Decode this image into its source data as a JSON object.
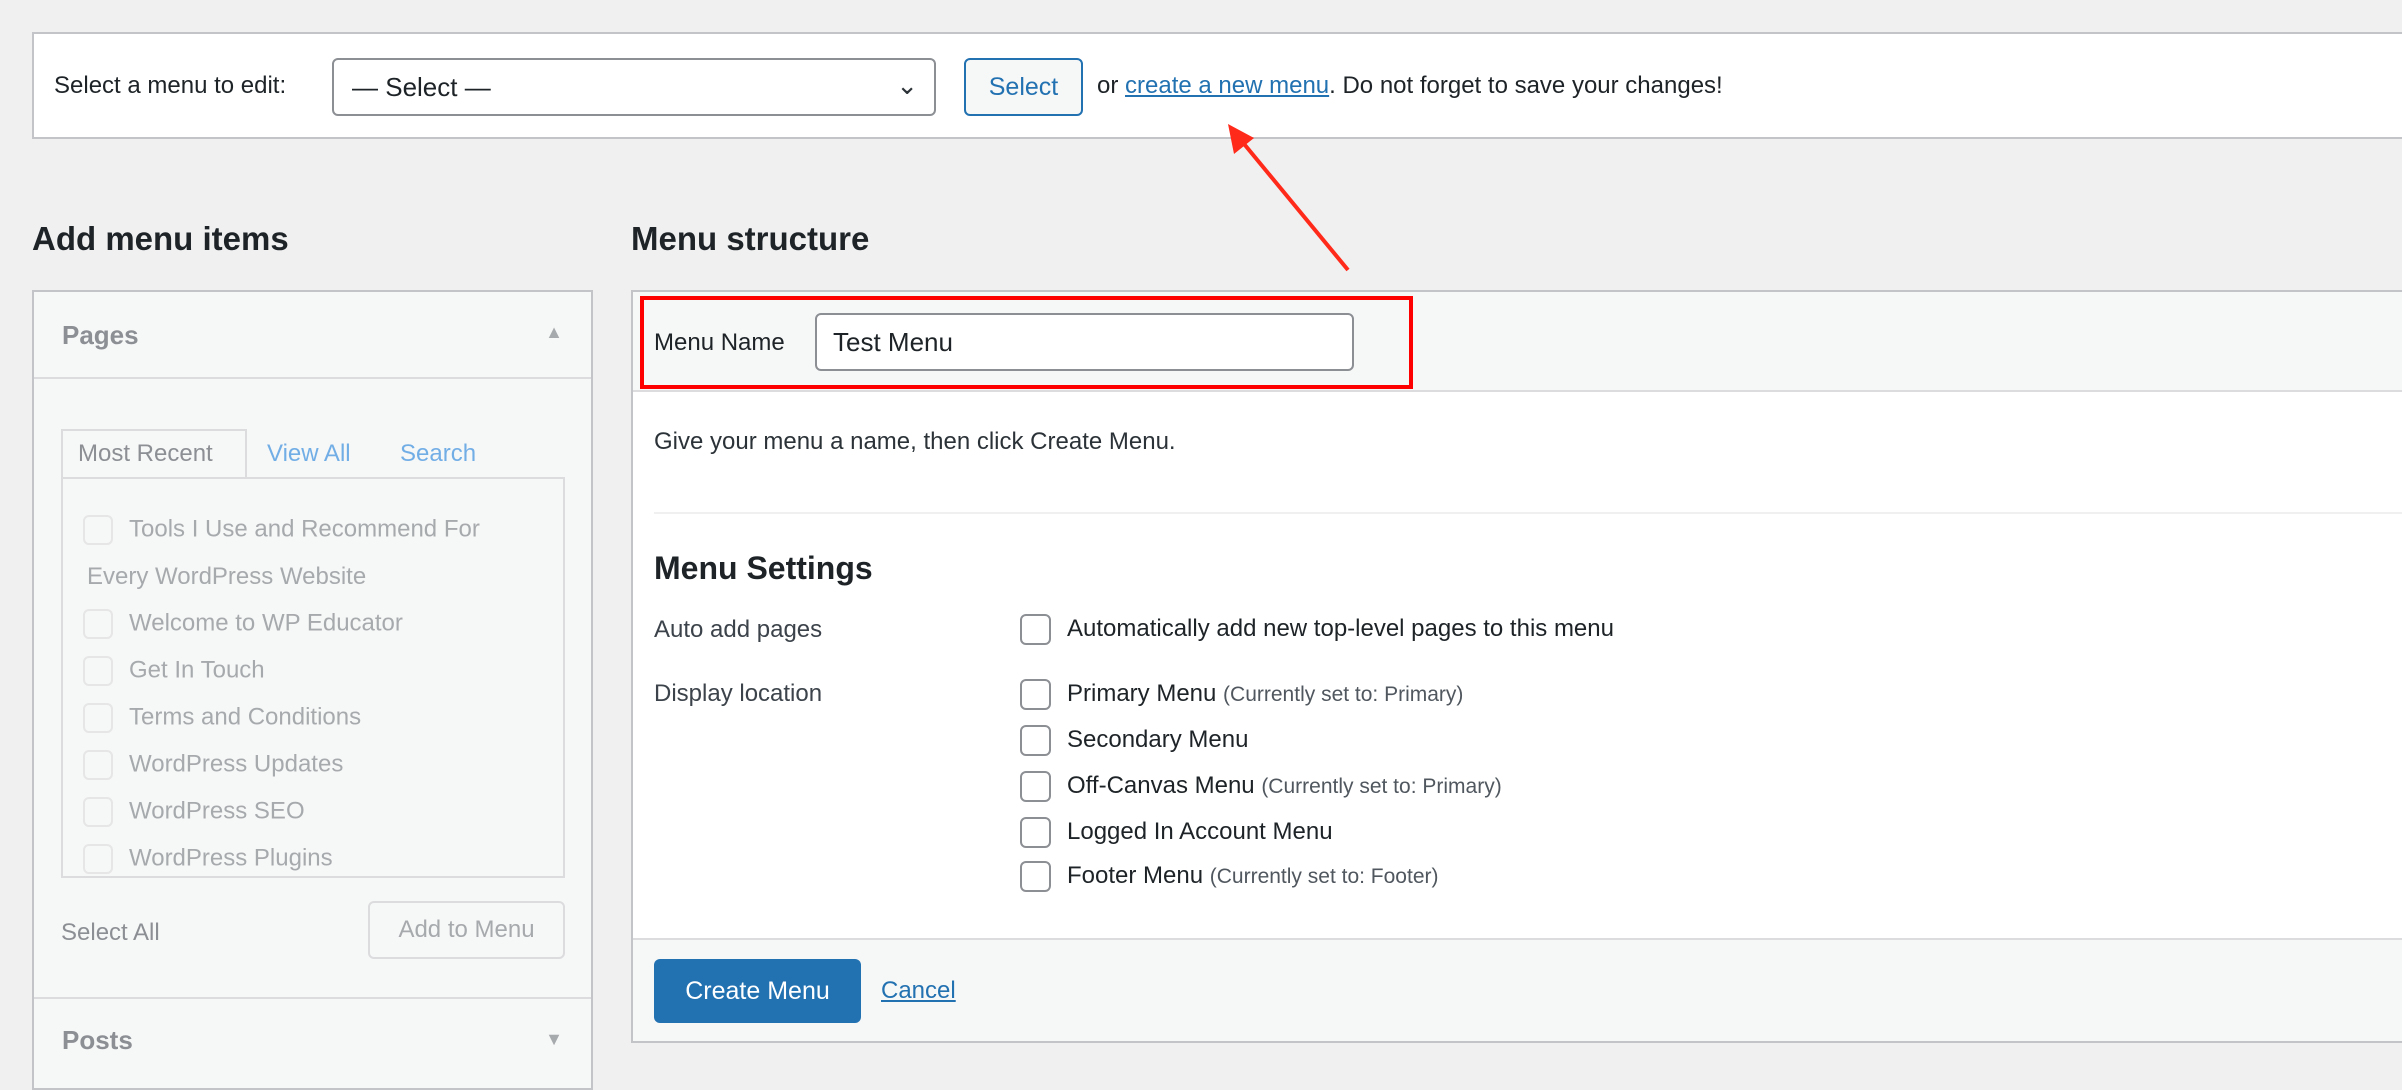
{
  "top_bar": {
    "label": "Select a menu to edit:",
    "dropdown_value": "— Select —",
    "select_button": "Select",
    "or_text": "or ",
    "create_link": "create a new menu",
    "after_text": ". Do not forget to save your changes!"
  },
  "left": {
    "heading": "Add menu items",
    "pages_title": "Pages",
    "tabs": [
      "Most Recent",
      "View All",
      "Search"
    ],
    "pages": [
      "Tools I Use and Recommend For",
      "Every WordPress Website",
      "Welcome to WP Educator",
      "Get In Touch",
      "Terms and Conditions",
      "WordPress Updates",
      "WordPress SEO",
      "WordPress Plugins"
    ],
    "select_all": "Select All",
    "add_to_menu": "Add to Menu",
    "posts_title": "Posts"
  },
  "right": {
    "heading": "Menu structure",
    "menu_name_label": "Menu Name",
    "menu_name_value": "Test Menu",
    "instructions": "Give your menu a name, then click Create Menu.",
    "settings_heading": "Menu Settings",
    "auto_add_label": "Auto add pages",
    "auto_add_option": "Automatically add new top-level pages to this menu",
    "display_location_label": "Display location",
    "locations": [
      {
        "name": "Primary Menu",
        "note": "(Currently set to: Primary)"
      },
      {
        "name": "Secondary Menu",
        "note": ""
      },
      {
        "name": "Off-Canvas Menu",
        "note": "(Currently set to: Primary)"
      },
      {
        "name": "Logged In Account Menu",
        "note": ""
      },
      {
        "name": "Footer Menu",
        "note": "(Currently set to: Footer)"
      }
    ],
    "create_button": "Create Menu",
    "cancel_link": "Cancel"
  },
  "colors": {
    "accent": "#2271b1",
    "annotation": "#ff0000"
  }
}
